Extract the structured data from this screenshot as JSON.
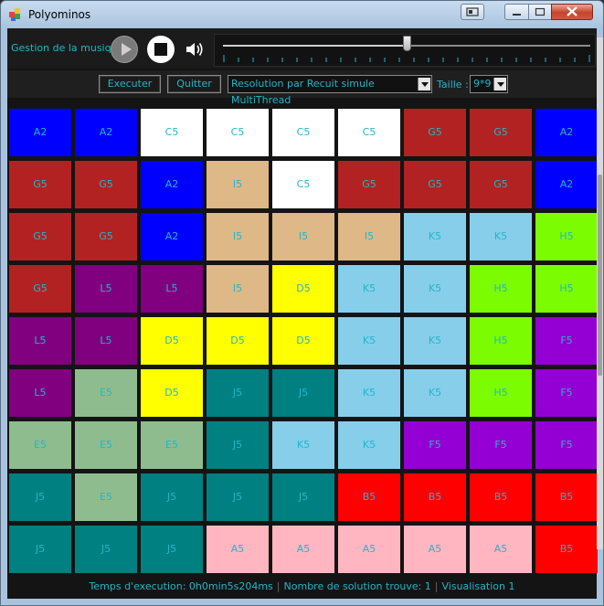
{
  "window": {
    "title": "Polyominos"
  },
  "music": {
    "label": "Gestion de la musique",
    "icons": {
      "play": "play-icon",
      "stop": "stop-icon",
      "volume": "volume-icon"
    },
    "progress": 0.5
  },
  "controls": {
    "execute_label": "Executer",
    "quit_label": "Quitter",
    "method_value": "Resolution par Recuit simule MultiThread",
    "size_label": "Taille :",
    "size_value": "9*9"
  },
  "colors": {
    "A": "#0000ff",
    "C": "#ffffff",
    "G": "#b22222",
    "I": "#deb887",
    "K": "#87ceeb",
    "H": "#7cfc00",
    "L": "#800080",
    "D": "#ffff00",
    "F": "#9400d3",
    "E": "#8fbc8f",
    "J": "#008080",
    "B": "#ff0000",
    "A5": "#ffb6c1",
    "text": "#23b6c8"
  },
  "grid": [
    [
      "A2",
      "A2",
      "C5",
      "C5",
      "C5",
      "C5",
      "G5",
      "G5",
      "A2"
    ],
    [
      "G5",
      "G5",
      "A2",
      "I5",
      "C5",
      "G5",
      "G5",
      "G5",
      "A2"
    ],
    [
      "G5",
      "G5",
      "A2",
      "I5",
      "I5",
      "I5",
      "K5",
      "K5",
      "H5"
    ],
    [
      "G5",
      "L5",
      "L5",
      "I5",
      "D5",
      "K5",
      "K5",
      "H5",
      "H5"
    ],
    [
      "L5",
      "L5",
      "D5",
      "D5",
      "D5",
      "K5",
      "K5",
      "H5",
      "F5"
    ],
    [
      "L5",
      "E5",
      "D5",
      "J5",
      "J5",
      "K5",
      "K5",
      "H5",
      "F5"
    ],
    [
      "E5",
      "E5",
      "E5",
      "J5",
      "K5",
      "K5",
      "F5",
      "F5",
      "F5"
    ],
    [
      "J5",
      "E5",
      "J5",
      "J5",
      "J5",
      "B5",
      "B5",
      "B5",
      "B5"
    ],
    [
      "J5",
      "J5",
      "J5",
      "A5",
      "A5",
      "A5",
      "A5",
      "A5",
      "B5"
    ]
  ],
  "status": {
    "time": "Temps d'execution: 0h0min5s204ms",
    "solutions": "Nombre de solution trouve: 1",
    "visualisation": "Visualisation 1"
  }
}
